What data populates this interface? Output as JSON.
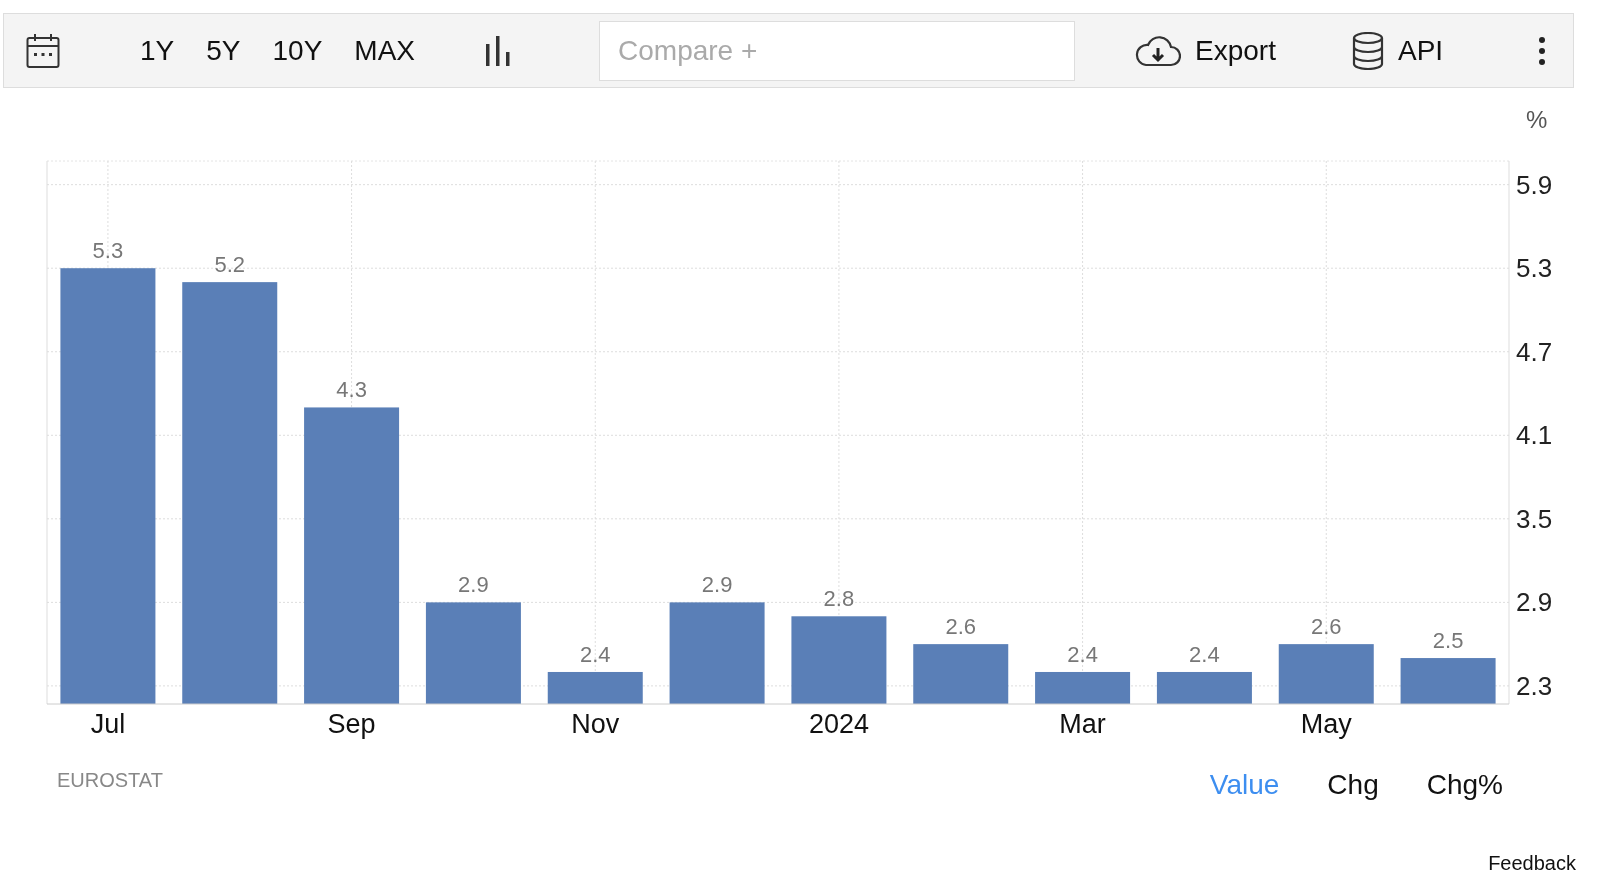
{
  "toolbar": {
    "ranges": [
      "1Y",
      "5Y",
      "10Y",
      "MAX"
    ],
    "compare": {
      "placeholder": "Compare +"
    },
    "export": "Export",
    "api": "API"
  },
  "chart": {
    "chart_data": {
      "type": "bar",
      "ylabel": "%",
      "categories": [
        "Jul",
        null,
        "Sep",
        null,
        "Nov",
        null,
        "2024",
        null,
        "Mar",
        null,
        "May",
        null
      ],
      "values": [
        5.3,
        5.2,
        4.3,
        2.9,
        2.4,
        2.9,
        2.8,
        2.6,
        2.4,
        2.4,
        2.6,
        2.5
      ],
      "yticks": [
        2.3,
        2.9,
        3.5,
        4.1,
        4.7,
        5.3,
        5.9
      ],
      "ylim": [
        2.17,
        6.07
      ],
      "grid": true,
      "data_labels": true
    }
  },
  "source": "EUROSTAT",
  "modes": [
    {
      "label": "Value",
      "selected": true
    },
    {
      "label": "Chg",
      "selected": false
    },
    {
      "label": "Chg%",
      "selected": false
    }
  ],
  "feedback": "Feedback"
}
